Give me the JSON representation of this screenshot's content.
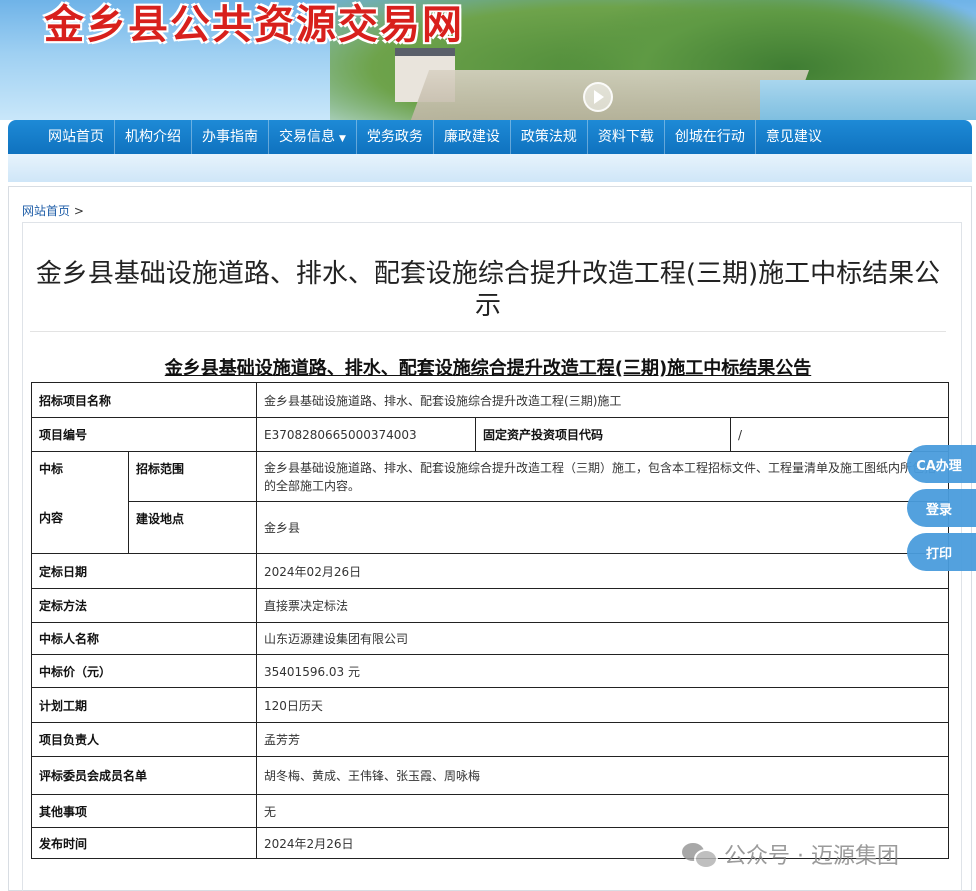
{
  "site": {
    "title": "金乡县公共资源交易网"
  },
  "nav": {
    "items": [
      "网站首页",
      "机构介绍",
      "办事指南",
      "交易信息",
      "党务政务",
      "廉政建设",
      "政策法规",
      "资料下载",
      "创城在行动",
      "意见建议"
    ]
  },
  "breadcrumb": {
    "home": "网站首页",
    "separator": ">"
  },
  "page": {
    "title": "金乡县基础设施道路、排水、配套设施综合提升改造工程(三期)施工中标结果公示",
    "doc_title": "金乡县基础设施道路、排水、配套设施综合提升改造工程(三期)施工中标结果公告"
  },
  "table": {
    "project_name_label": "招标项目名称",
    "project_name": "金乡县基础设施道路、排水、配套设施综合提升改造工程(三期)施工",
    "project_no_label": "项目编号",
    "project_no": "E3708280665000374003",
    "fixed_asset_label": "固定资产投资项目代码",
    "fixed_asset": "/",
    "bid_content_label_1": "中标",
    "bid_content_label_2": "内容",
    "scope_label": "招标范围",
    "scope": "金乡县基础设施道路、排水、配套设施综合提升改造工程（三期）施工，包含本工程招标文件、工程量清单及施工图纸内所包括的全部施工内容。",
    "location_label": "建设地点",
    "location": "金乡县",
    "date_label": "定标日期",
    "date": "2024年02月26日",
    "method_label": "定标方法",
    "method": "直接票决定标法",
    "winner_label": "中标人名称",
    "winner": "山东迈源建设集团有限公司",
    "price_label": "中标价（元）",
    "price": "35401596.03 元",
    "period_label": "计划工期",
    "period": "120日历天",
    "manager_label": "项目负责人",
    "manager": "孟芳芳",
    "committee_label": "评标委员会成员名单",
    "committee": "胡冬梅、黄成、王伟锋、张玉霞、周咏梅",
    "other_label": "其他事项",
    "other": "无",
    "publish_label": "发布时间",
    "publish": "2024年2月26日"
  },
  "side_buttons": {
    "ca": "CA办理",
    "login": "登录",
    "print": "打印"
  },
  "watermark": {
    "text": "公众号 · 迈源集团"
  },
  "colors": {
    "nav_blue": "#0f72bf",
    "title_red": "#d8201c",
    "side_button": "#4a9ddd"
  }
}
